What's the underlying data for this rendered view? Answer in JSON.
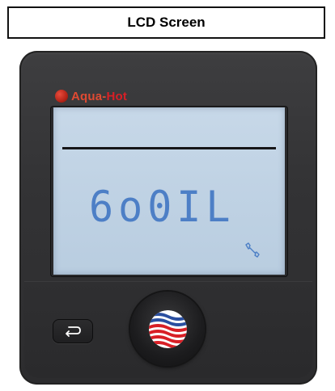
{
  "header": {
    "title": "LCD Screen"
  },
  "brand": {
    "name_part1": "Aqua-",
    "name_part2": "Hot"
  },
  "display": {
    "text": "6o0IL",
    "status_icon": "wrench-icon"
  },
  "controls": {
    "back_icon": "return-arrow-icon",
    "knob_icon": "aqua-hot-logo-icon"
  },
  "colors": {
    "lcd_background": "#c3d5e6",
    "lcd_segment": "#4d7fc6",
    "housing": "#333335",
    "brand_red": "#d81f26"
  }
}
